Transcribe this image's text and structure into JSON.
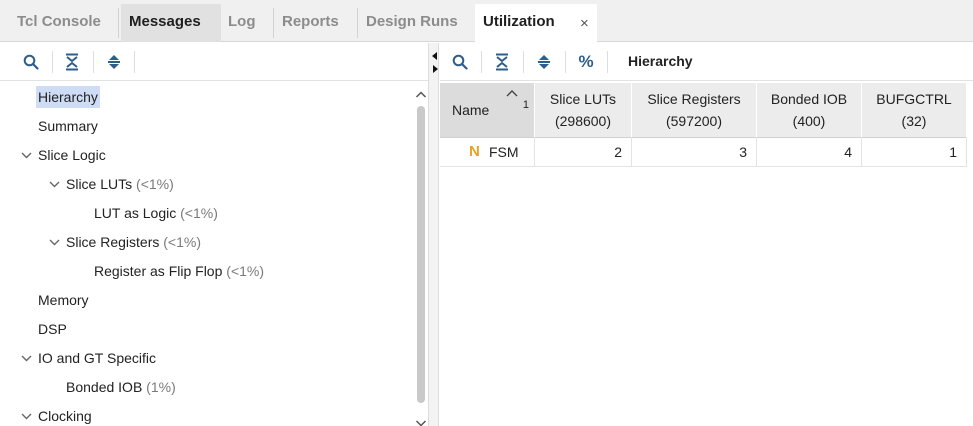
{
  "tabs": [
    {
      "label": "Tcl Console"
    },
    {
      "label": "Messages"
    },
    {
      "label": "Log"
    },
    {
      "label": "Reports"
    },
    {
      "label": "Design Runs"
    },
    {
      "label": "Utilization"
    }
  ],
  "close_glyph": "×",
  "right_toolbar": {
    "percent_label": "%",
    "title": "Hierarchy"
  },
  "tree": [
    {
      "label": "Hierarchy",
      "pct": "",
      "selected": true
    },
    {
      "label": "Summary",
      "pct": ""
    },
    {
      "label": "Slice Logic",
      "pct": "",
      "expanded": true
    },
    {
      "label": "Slice LUTs",
      "pct": "(<1%)",
      "expanded": true
    },
    {
      "label": "LUT as Logic",
      "pct": "(<1%)"
    },
    {
      "label": "Slice Registers",
      "pct": "(<1%)",
      "expanded": true
    },
    {
      "label": "Register as Flip Flop",
      "pct": "(<1%)"
    },
    {
      "label": "Memory",
      "pct": ""
    },
    {
      "label": "DSP",
      "pct": ""
    },
    {
      "label": "IO and GT Specific",
      "pct": "",
      "expanded": true
    },
    {
      "label": "Bonded IOB",
      "pct": "(1%)"
    },
    {
      "label": "Clocking",
      "pct": "",
      "expanded": true
    }
  ],
  "table": {
    "headers": [
      {
        "line1": "Name",
        "line2": "",
        "sort_index": "1"
      },
      {
        "line1": "Slice LUTs",
        "line2": "(298600)"
      },
      {
        "line1": "Slice Registers",
        "line2": "(597200)"
      },
      {
        "line1": "Bonded IOB",
        "line2": "(400)"
      },
      {
        "line1": "BUFGCTRL",
        "line2": "(32)"
      }
    ],
    "rows": [
      {
        "icon": "N",
        "name": "FSM",
        "values": [
          "2",
          "3",
          "4",
          "1"
        ]
      }
    ]
  },
  "colors": {
    "accent": "#2f5d8a",
    "selection": "#cfdcf5",
    "module_icon": "#e8a21d"
  }
}
